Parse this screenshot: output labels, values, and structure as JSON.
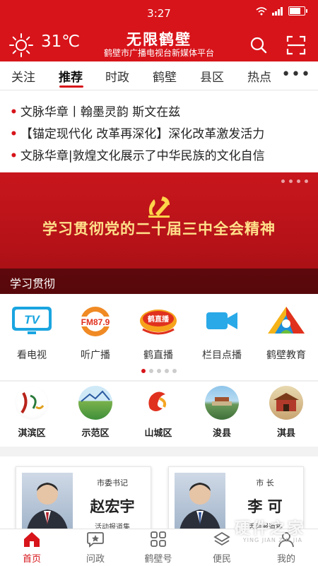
{
  "status_bar": {
    "time": "3:27",
    "signal": "信号",
    "battery_level": 0.85
  },
  "header": {
    "temperature": "31℃",
    "title": "无限鹤壁",
    "subtitle": "鹤壁市广播电视台新媒体平台"
  },
  "tabs": [
    "关注",
    "推荐",
    "时政",
    "鹤壁",
    "县区",
    "热点"
  ],
  "active_tab": "推荐",
  "headlines": [
    "文脉华章丨翰墨灵韵 斯文在兹",
    "【锚定现代化 改革再深化】深化改革激发活力",
    "文脉华章|敦煌文化展示了中华民族的文化自信"
  ],
  "banner": {
    "title": "学习贯彻党的二十届三中全会精神",
    "caption": "学习贯彻"
  },
  "services": [
    {
      "label": "看电视",
      "icon": "tv-icon"
    },
    {
      "label": "听广播",
      "icon": "radio-icon"
    },
    {
      "label": "鹤直播",
      "icon": "live-icon"
    },
    {
      "label": "栏目点播",
      "icon": "video-icon"
    },
    {
      "label": "鹤壁教育",
      "icon": "education-icon"
    }
  ],
  "service_tv_text": "TV",
  "service_fm_text": "FM87.9",
  "service_live_text": "鹤直播",
  "districts": [
    "淇滨区",
    "示范区",
    "山城区",
    "浚县",
    "淇县"
  ],
  "leaders": [
    {
      "role": "市委书记",
      "name": "赵宏宇",
      "sub": "活动报道集"
    },
    {
      "role": "市 长",
      "name": "李 可",
      "sub": "活动报道集"
    }
  ],
  "bottom_nav": [
    "首页",
    "问政",
    "鹤壁号",
    "便民",
    "我的"
  ],
  "watermark": "硬件之家",
  "watermark_sub": "YING JIAN ZHI JIA",
  "colors": {
    "brand_red": "#d7141a",
    "banner_gold": "#ffe08a"
  }
}
